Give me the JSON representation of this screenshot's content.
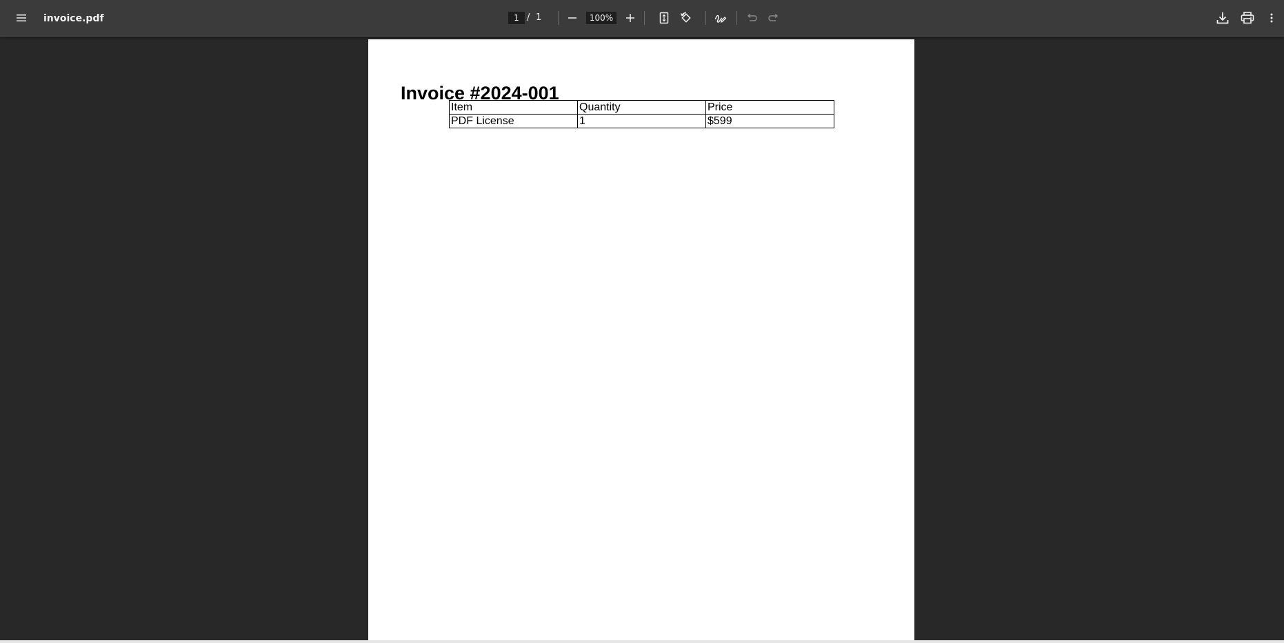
{
  "toolbar": {
    "title": "invoice.pdf",
    "page_current": "1",
    "page_separator": "/",
    "page_total": "1",
    "zoom": "100%",
    "icons": {
      "menu": "menu-icon",
      "zoom_out": "minus-icon",
      "zoom_in": "plus-icon",
      "fit": "fit-page-icon",
      "rotate": "rotate-icon",
      "annotate": "draw-icon",
      "undo": "undo-icon",
      "redo": "redo-icon",
      "download": "download-icon",
      "print": "print-icon",
      "more": "more-vertical-icon"
    }
  },
  "document": {
    "heading": "Invoice #2024-001",
    "table": {
      "headers": [
        "Item",
        "Quantity",
        "Price"
      ],
      "rows": [
        [
          "PDF License",
          "1",
          "$599"
        ]
      ]
    }
  },
  "colors": {
    "toolbar_bg": "#3b3b3b",
    "viewer_bg": "#282828",
    "page_bg": "#ffffff",
    "toolbar_text": "#f1f1f1"
  }
}
